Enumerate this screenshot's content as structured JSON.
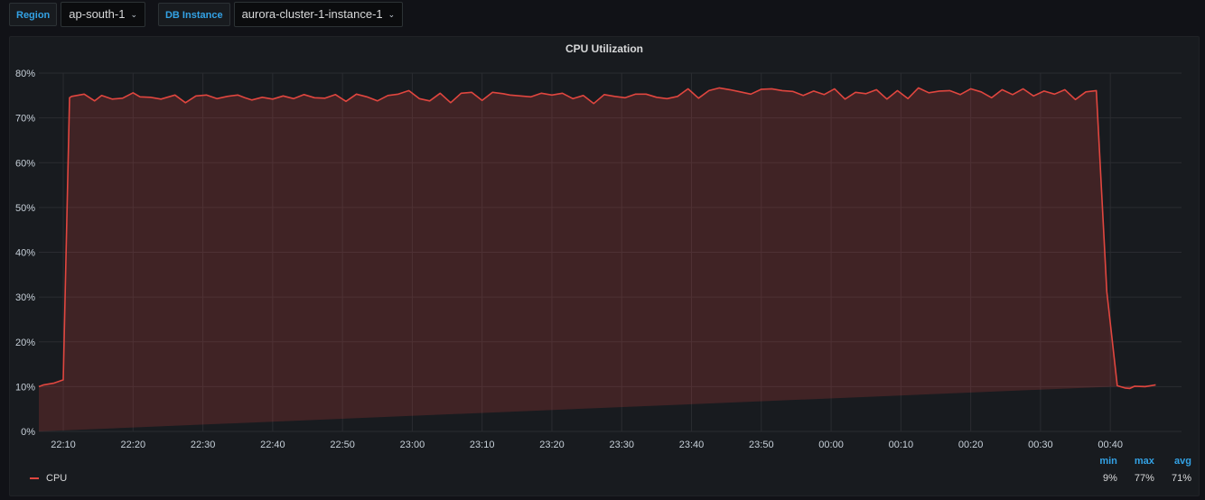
{
  "variables": {
    "region": {
      "label": "Region",
      "value": "ap-south-1"
    },
    "db_instance": {
      "label": "DB Instance",
      "value": "aurora-cluster-1-instance-1"
    }
  },
  "panel": {
    "title": "CPU Utilization"
  },
  "chart_data": {
    "type": "area",
    "title": "CPU Utilization",
    "y_ticks": [
      "0%",
      "10%",
      "20%",
      "30%",
      "40%",
      "50%",
      "60%",
      "70%",
      "80%"
    ],
    "ylim": [
      0,
      80
    ],
    "x_ticks": [
      "22:10",
      "22:20",
      "22:30",
      "22:40",
      "22:50",
      "23:00",
      "23:10",
      "23:20",
      "23:30",
      "23:40",
      "23:50",
      "00:00",
      "00:10",
      "00:20",
      "00:30",
      "00:40"
    ],
    "x_range_minutes": [
      -3.5,
      160.2
    ],
    "grid": true,
    "series": [
      {
        "name": "CPU",
        "color": "#e0463f",
        "x_minutes": [
          -3.5,
          -2.8,
          -1.3,
          0.0,
          0.9,
          1.2,
          3.0,
          4.5,
          5.5,
          7.0,
          8.5,
          10,
          11,
          12.5,
          14,
          16,
          17.5,
          19,
          20.5,
          22,
          23.5,
          25,
          26,
          27,
          28.5,
          30,
          31.5,
          33,
          34.5,
          36,
          37.5,
          39,
          40.5,
          42,
          43.5,
          45,
          46.5,
          48,
          49.5,
          51,
          52.5,
          54,
          55.5,
          57,
          58.5,
          60,
          61.5,
          63,
          64,
          65.5,
          67,
          68.5,
          70,
          71.5,
          73,
          74.5,
          76,
          77.5,
          79,
          80.5,
          82,
          83.5,
          85,
          86.5,
          88,
          89.5,
          91,
          92.5,
          94,
          95.5,
          97,
          98.5,
          100,
          101.5,
          103,
          104.5,
          106,
          107.5,
          109,
          110.5,
          112,
          113.5,
          115,
          116.5,
          118,
          119.5,
          121,
          122.5,
          124,
          125.5,
          127,
          128.5,
          130,
          131.5,
          133,
          134.5,
          136,
          137.5,
          139,
          140.5,
          142,
          143.5,
          145,
          146.5,
          148,
          149.5,
          151,
          152.1,
          152.8,
          153.5,
          155,
          156.5,
          158,
          159.5,
          160.2
        ],
        "values": [
          10,
          10.4,
          10.8,
          11.5,
          74.5,
          74.8,
          75.3,
          73.8,
          75,
          74.2,
          74.4,
          75.6,
          74.7,
          74.6,
          74.2,
          75.1,
          73.4,
          74.9,
          75.1,
          74.3,
          74.8,
          75.1,
          74.5,
          74,
          74.6,
          74.2,
          74.9,
          74.3,
          75.2,
          74.5,
          74.4,
          75.2,
          73.7,
          75.3,
          74.7,
          73.8,
          75,
          75.3,
          76.1,
          74.3,
          73.8,
          75.5,
          73.4,
          75.5,
          75.7,
          73.9,
          75.7,
          75.4,
          75.1,
          74.9,
          74.7,
          75.5,
          75.1,
          75.5,
          74.3,
          75,
          73.2,
          75.2,
          74.8,
          74.5,
          75.3,
          75.3,
          74.6,
          74.3,
          74.8,
          76.5,
          74.4,
          76.1,
          76.7,
          76.3,
          75.8,
          75.3,
          76.4,
          76.5,
          76.1,
          75.9,
          75,
          76,
          75.2,
          76.5,
          74.2,
          75.7,
          75.4,
          76.3,
          74.2,
          76.1,
          74.3,
          76.7,
          75.6,
          76,
          76.1,
          75.2,
          76.5,
          75.8,
          74.5,
          76.3,
          75.2,
          76.5,
          74.9,
          76,
          75.3,
          76.3,
          74.1,
          75.8,
          76.1,
          31.2,
          10.2,
          9.7,
          9.6,
          10.1,
          10,
          10.4
        ]
      }
    ],
    "legend": {
      "placement": "bottom",
      "stat_headers": [
        "min",
        "max",
        "avg"
      ],
      "stat_values": [
        "9%",
        "77%",
        "71%"
      ]
    }
  }
}
